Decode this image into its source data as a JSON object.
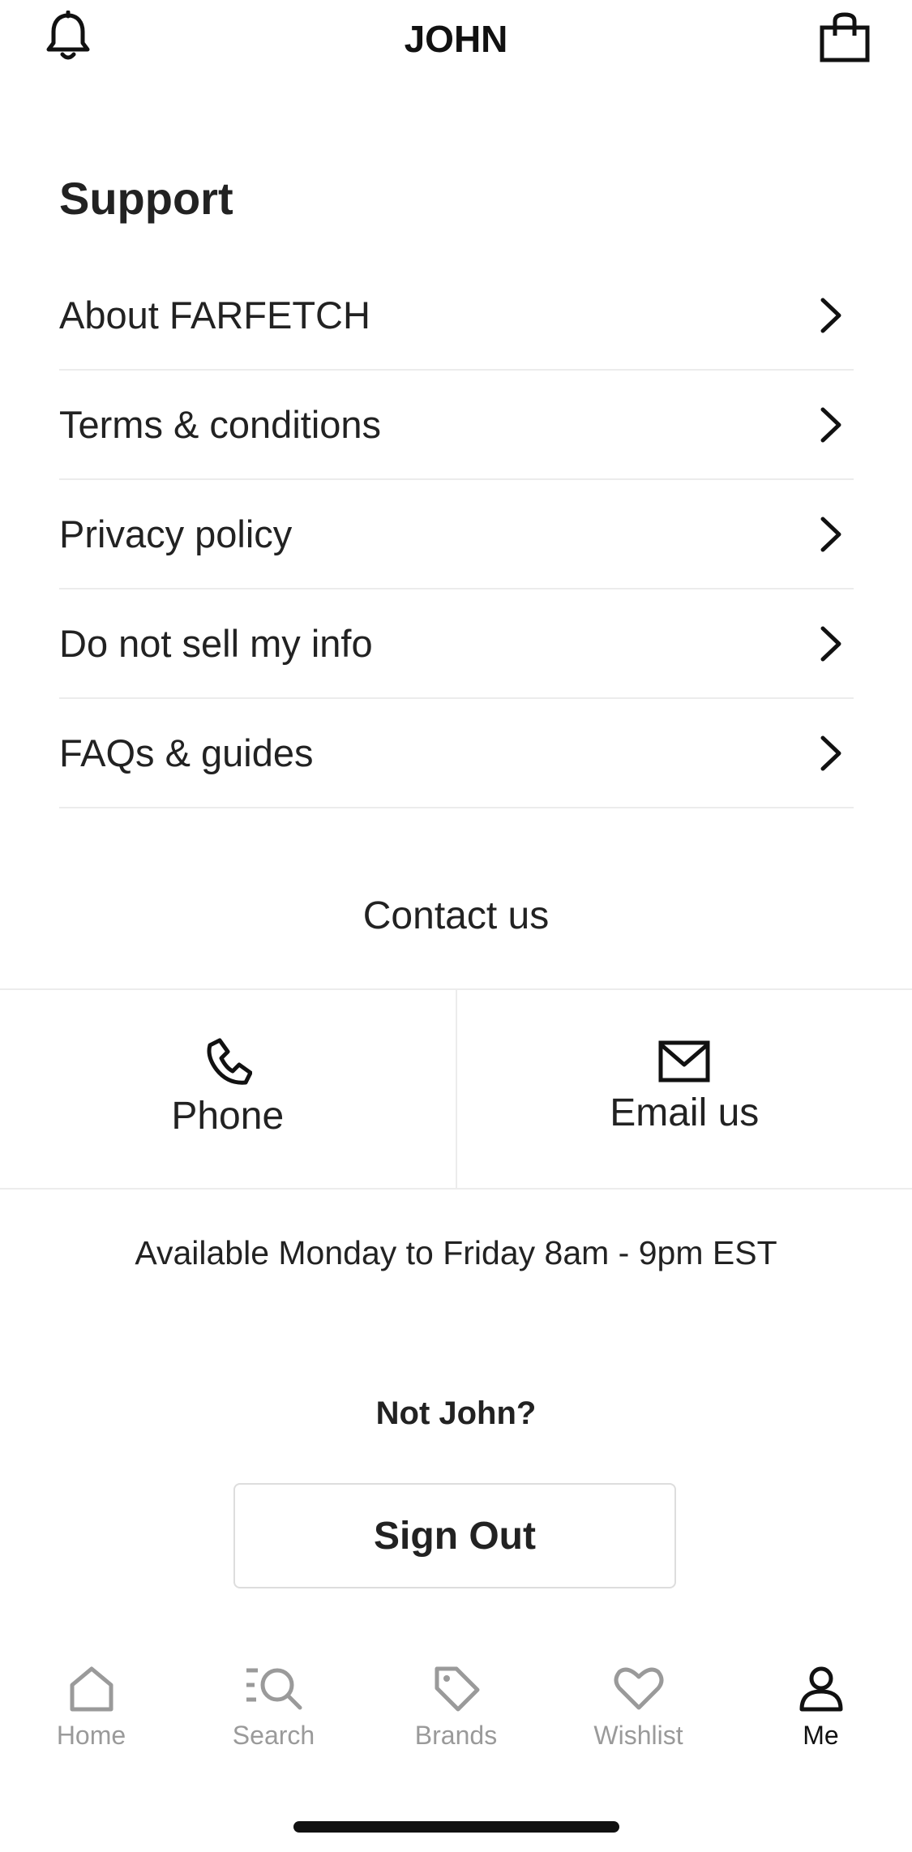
{
  "header": {
    "title": "JOHN",
    "left_icon": "bell-icon",
    "right_icon": "shopping-bag-icon"
  },
  "support": {
    "title": "Support",
    "items": [
      {
        "label": "About FARFETCH"
      },
      {
        "label": "Terms & conditions"
      },
      {
        "label": "Privacy policy"
      },
      {
        "label": "Do not sell my info"
      },
      {
        "label": "FAQs & guides"
      }
    ]
  },
  "contact": {
    "title": "Contact us",
    "phone_label": "Phone",
    "email_label": "Email us",
    "availability": "Available Monday to Friday 8am - 9pm EST"
  },
  "account": {
    "not_user": "Not John?",
    "sign_out_label": "Sign Out"
  },
  "tabbar": {
    "items": [
      {
        "label": "Home",
        "icon": "home-icon",
        "active": false
      },
      {
        "label": "Search",
        "icon": "search-icon",
        "active": false
      },
      {
        "label": "Brands",
        "icon": "tag-icon",
        "active": false
      },
      {
        "label": "Wishlist",
        "icon": "heart-icon",
        "active": false
      },
      {
        "label": "Me",
        "icon": "person-icon",
        "active": true
      }
    ],
    "active_color": "#111111",
    "inactive_color": "#9a9a9a"
  }
}
